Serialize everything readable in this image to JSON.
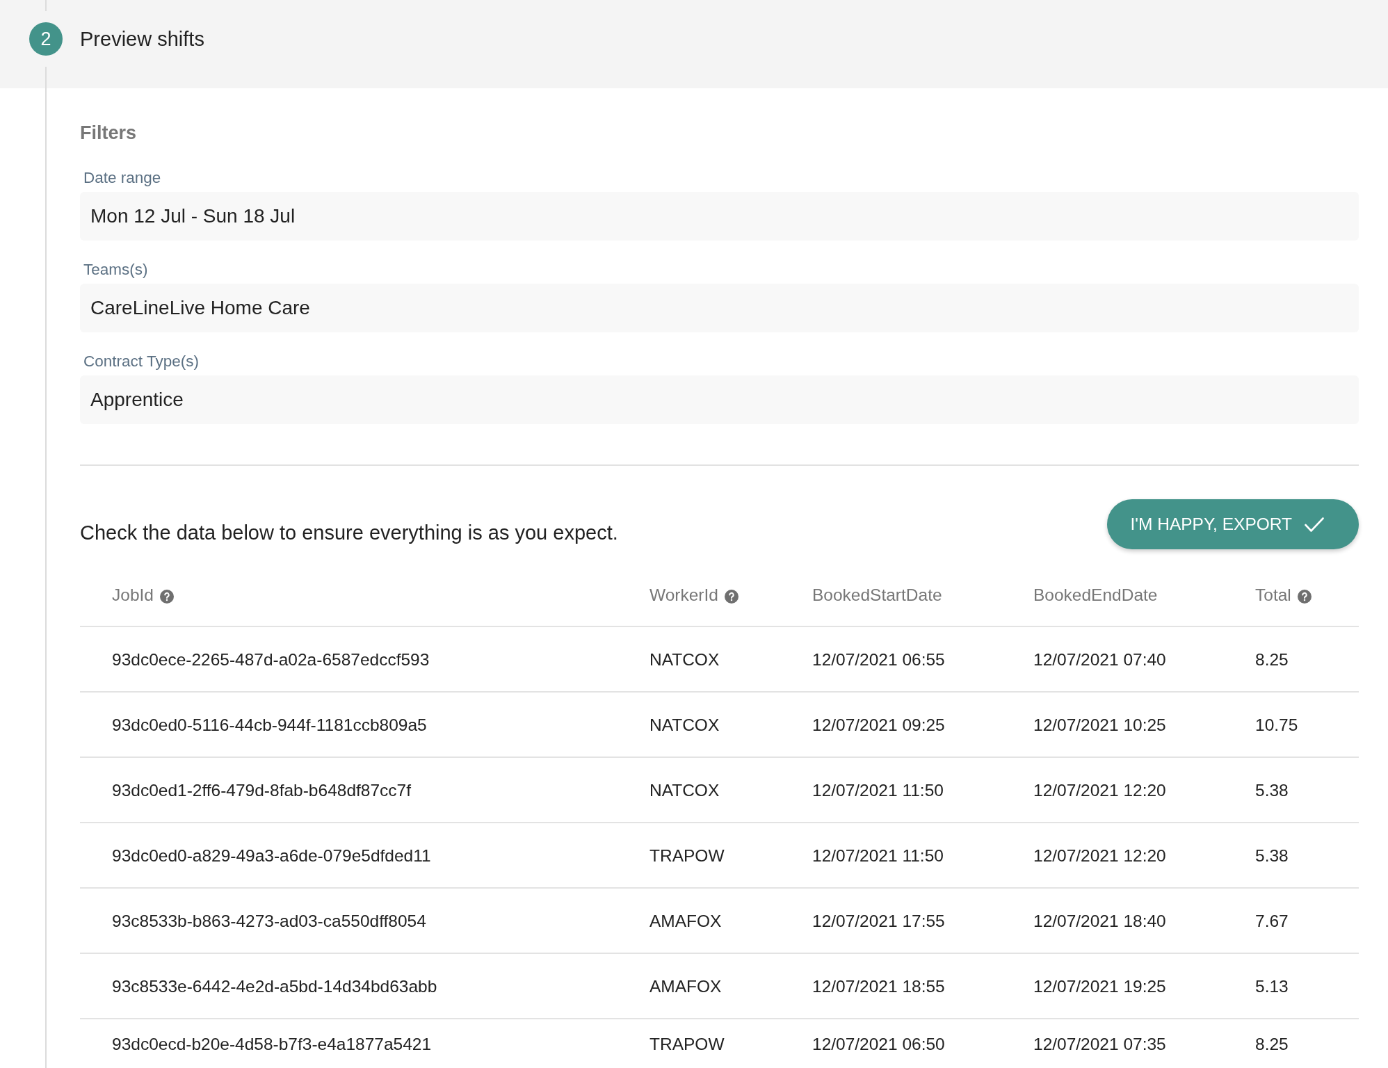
{
  "step": {
    "number": "2",
    "title": "Preview shifts"
  },
  "filters": {
    "heading": "Filters",
    "fields": [
      {
        "label": "Date range",
        "value": "Mon 12 Jul - Sun 18 Jul"
      },
      {
        "label": "Teams(s)",
        "value": "CareLineLive Home Care"
      },
      {
        "label": "Contract Type(s)",
        "value": "Apprentice"
      }
    ]
  },
  "instructions": "Check the data below to ensure everything is as you expect.",
  "export_button": {
    "label": "I'M HAPPY, EXPORT"
  },
  "table": {
    "columns": [
      {
        "label": "JobId",
        "help": true
      },
      {
        "label": "WorkerId",
        "help": true
      },
      {
        "label": "BookedStartDate",
        "help": false
      },
      {
        "label": "BookedEndDate",
        "help": false
      },
      {
        "label": "Total",
        "help": true
      }
    ],
    "rows": [
      [
        "93dc0ece-2265-487d-a02a-6587edccf593",
        "NATCOX",
        "12/07/2021 06:55",
        "12/07/2021 07:40",
        "8.25"
      ],
      [
        "93dc0ed0-5116-44cb-944f-1181ccb809a5",
        "NATCOX",
        "12/07/2021 09:25",
        "12/07/2021 10:25",
        "10.75"
      ],
      [
        "93dc0ed1-2ff6-479d-8fab-b648df87cc7f",
        "NATCOX",
        "12/07/2021 11:50",
        "12/07/2021 12:20",
        "5.38"
      ],
      [
        "93dc0ed0-a829-49a3-a6de-079e5dfded11",
        "TRAPOW",
        "12/07/2021 11:50",
        "12/07/2021 12:20",
        "5.38"
      ],
      [
        "93c8533b-b863-4273-ad03-ca550dff8054",
        "AMAFOX",
        "12/07/2021 17:55",
        "12/07/2021 18:40",
        "7.67"
      ],
      [
        "93c8533e-6442-4e2d-a5bd-14d34bd63abb",
        "AMAFOX",
        "12/07/2021 18:55",
        "12/07/2021 19:25",
        "5.13"
      ],
      [
        "93dc0ecd-b20e-4d58-b7f3-e4a1877a5421",
        "TRAPOW",
        "12/07/2021 06:50",
        "12/07/2021 07:35",
        "8.25"
      ]
    ]
  }
}
